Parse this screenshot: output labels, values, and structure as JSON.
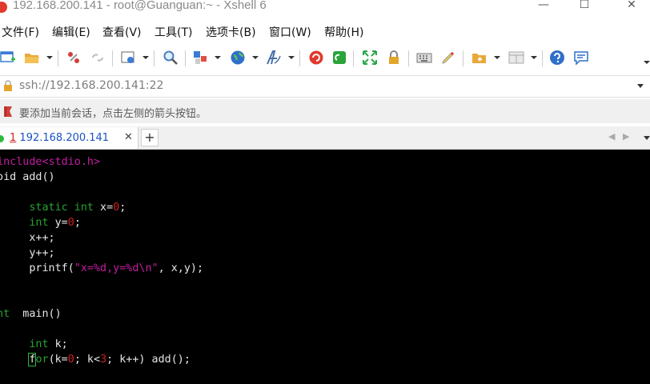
{
  "window": {
    "title": "192.168.200.141 - root@Guanguan:~ - Xshell 6",
    "controls": [
      "—",
      "☐",
      "✕"
    ]
  },
  "menu": [
    "文件(F)",
    "编辑(E)",
    "查看(V)",
    "工具(T)",
    "选项卡(B)",
    "窗口(W)",
    "帮助(H)"
  ],
  "address": {
    "value": "ssh://192.168.200.141:22"
  },
  "hint": {
    "text": "要添加当前会话，点击左侧的箭头按钮。"
  },
  "tab": {
    "index": "1",
    "label": "192.168.200.141",
    "close": "✕",
    "new": "+"
  },
  "terminal": {
    "lines": [
      [
        [
          "pp",
          "#include"
        ],
        [
          "str",
          "<stdio.h>"
        ]
      ],
      [
        [
          "",
          "void add()"
        ]
      ],
      [
        [
          "",
          "{"
        ]
      ],
      [
        [
          "",
          "      "
        ],
        [
          "kw",
          "static"
        ],
        [
          "",
          ""
        ],
        [
          "kw",
          " int"
        ],
        [
          "",
          " x="
        ],
        [
          "num",
          "0"
        ],
        [
          "",
          ";"
        ]
      ],
      [
        [
          "",
          "      "
        ],
        [
          "kw",
          "int"
        ],
        [
          "",
          " y="
        ],
        [
          "num",
          "0"
        ],
        [
          "",
          ";"
        ]
      ],
      [
        [
          "",
          "      x++;"
        ]
      ],
      [
        [
          "",
          "      y++;"
        ]
      ],
      [
        [
          "",
          "      printf("
        ],
        [
          "str",
          "\"x=%d,y=%d\\n\""
        ],
        [
          "",
          ", x,y);"
        ]
      ],
      [
        [
          "",
          "}"
        ]
      ],
      [
        [
          "",
          ""
        ]
      ],
      [
        [
          "kw",
          "int"
        ],
        [
          "",
          "  main()"
        ]
      ],
      [
        [
          "",
          "{"
        ]
      ],
      [
        [
          "",
          "      "
        ],
        [
          "kw",
          "int"
        ],
        [
          "",
          " k;"
        ]
      ],
      [
        [
          "",
          "      "
        ],
        [
          "cursor",
          "f"
        ],
        [
          "kw",
          "or"
        ],
        [
          "",
          "(k="
        ],
        [
          "num",
          "0"
        ],
        [
          "",
          "; k<"
        ],
        [
          "num",
          "3"
        ],
        [
          "",
          "; k++) add();"
        ]
      ]
    ]
  }
}
